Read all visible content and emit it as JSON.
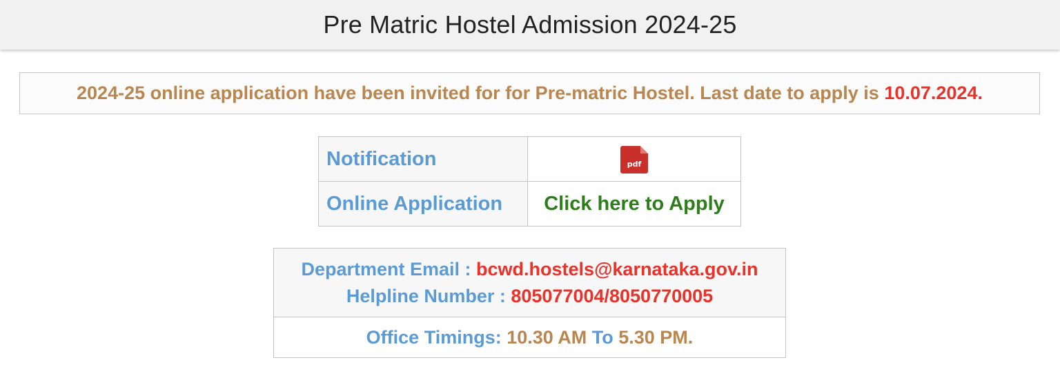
{
  "header": {
    "title": "Pre Matric Hostel Admission 2024-25"
  },
  "notice": {
    "text": "2024-25 online application have been invited for for Pre-matric Hostel. Last date to apply is ",
    "date": "10.07.2024."
  },
  "links": {
    "notification_label": "Notification",
    "pdf_icon_text": "pdf",
    "online_application_label": "Online Application",
    "apply_link": "Click here to Apply"
  },
  "contact": {
    "email_label": "Department Email : ",
    "email": "bcwd.hostels@karnataka.gov.in",
    "helpline_label": "Helpline Number : ",
    "helpline": "805077004/8050770005",
    "timings_label": "Office Timings: ",
    "time_start": "10.30 AM",
    "time_sep": " To ",
    "time_end": "5.30 PM."
  },
  "colors": {
    "label_blue": "#5b9bd5",
    "accent_red": "#e8322a",
    "text_brown": "#b8864e",
    "link_green": "#2e7d1c",
    "pdf_red": "#c9302c"
  },
  "icons": {
    "pdf": "pdf-file-icon"
  }
}
